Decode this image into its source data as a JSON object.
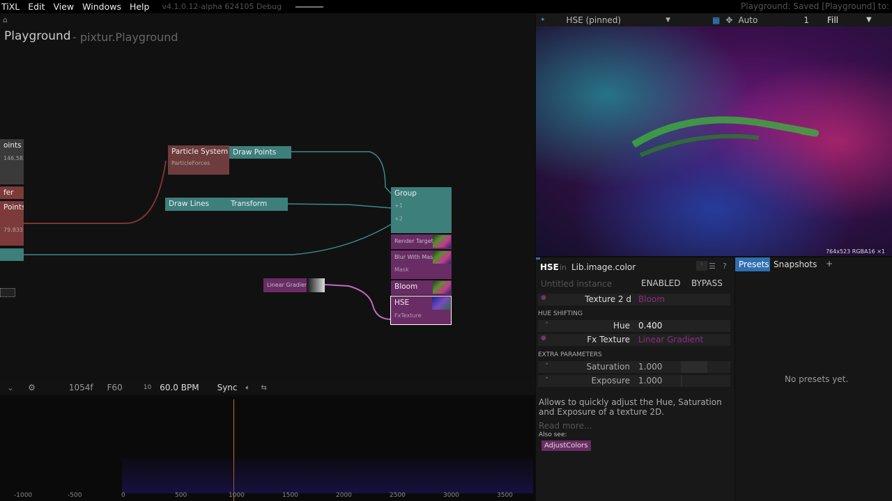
{
  "menubar": {
    "app": "TiXL",
    "items": [
      "Edit",
      "View",
      "Windows",
      "Help"
    ],
    "version": "v4.1.0.12-alpha 624105 Debug",
    "status": "Playground: Saved [Playground] to:"
  },
  "graph": {
    "title": "Playground",
    "subtitle": "- pixtur.Playground",
    "nodes": {
      "points_top": "oints",
      "points_top_val": "146.582",
      "fer": "fer",
      "points_mid": "Points",
      "points_mid_val": "79.833",
      "particle_system": "Particle System",
      "particle_forces": "ParticleForces",
      "draw_points": "Draw Points",
      "draw_lines": "Draw Lines",
      "transform": "Transform",
      "group": "Group",
      "group_in1": "+1",
      "group_in2": "+2",
      "render_target": "Render Target",
      "blur_with_mask": "Blur With Mask",
      "mask": "Mask",
      "bloom": "Bloom",
      "hse": "HSE",
      "fxtexture": "FxTexture",
      "linear_gradient": "Linear Gradient"
    }
  },
  "timeline": {
    "frames": "1054f",
    "fps": "F60",
    "beat": "10",
    "bpm": "60.0 BPM",
    "sync": "Sync",
    "ticks": [
      "-1000",
      "-500",
      "0",
      "500",
      "1000",
      "1500",
      "2000",
      "2500",
      "3000",
      "3500"
    ]
  },
  "viewer": {
    "pinned": "HSE (pinned)",
    "mode": "Auto",
    "count": "1",
    "fill": "Fill",
    "resolution": "764x523 RGBA16",
    "x_label": "×1"
  },
  "inspector": {
    "op": "HSE",
    "in": "in",
    "namespace": "Lib.image.color",
    "instance_placeholder": "Untitled instance",
    "enabled": "ENABLED",
    "bypass": "BYPASS",
    "texture_label": "Texture 2 d",
    "texture_val": "Bloom",
    "section1": "HUE SHIFTING",
    "hue_label": "Hue",
    "hue_val": "0.400",
    "fxtex_label": "Fx Texture",
    "fxtex_val": "Linear Gradient",
    "section2": "EXTRA PARAMETERS",
    "sat_label": "Saturation",
    "sat_val": "1.000",
    "exp_label": "Exposure",
    "exp_val": "1.000",
    "description": "Allows to quickly adjust the Hue, Saturation and Exposure of a texture 2D.",
    "read_more": "Read more...",
    "also_see": "Also see:",
    "adjust_colors": "AdjustColors"
  },
  "presets": {
    "tab_presets": "Presets",
    "tab_snapshots": "Snapshots",
    "add": "+",
    "empty": "No presets yet."
  },
  "colors": {
    "accent": "#2f6fb0",
    "node_teal": "#3d7f7b",
    "node_red": "#6e3c3c",
    "node_purple": "#6a2c65"
  }
}
